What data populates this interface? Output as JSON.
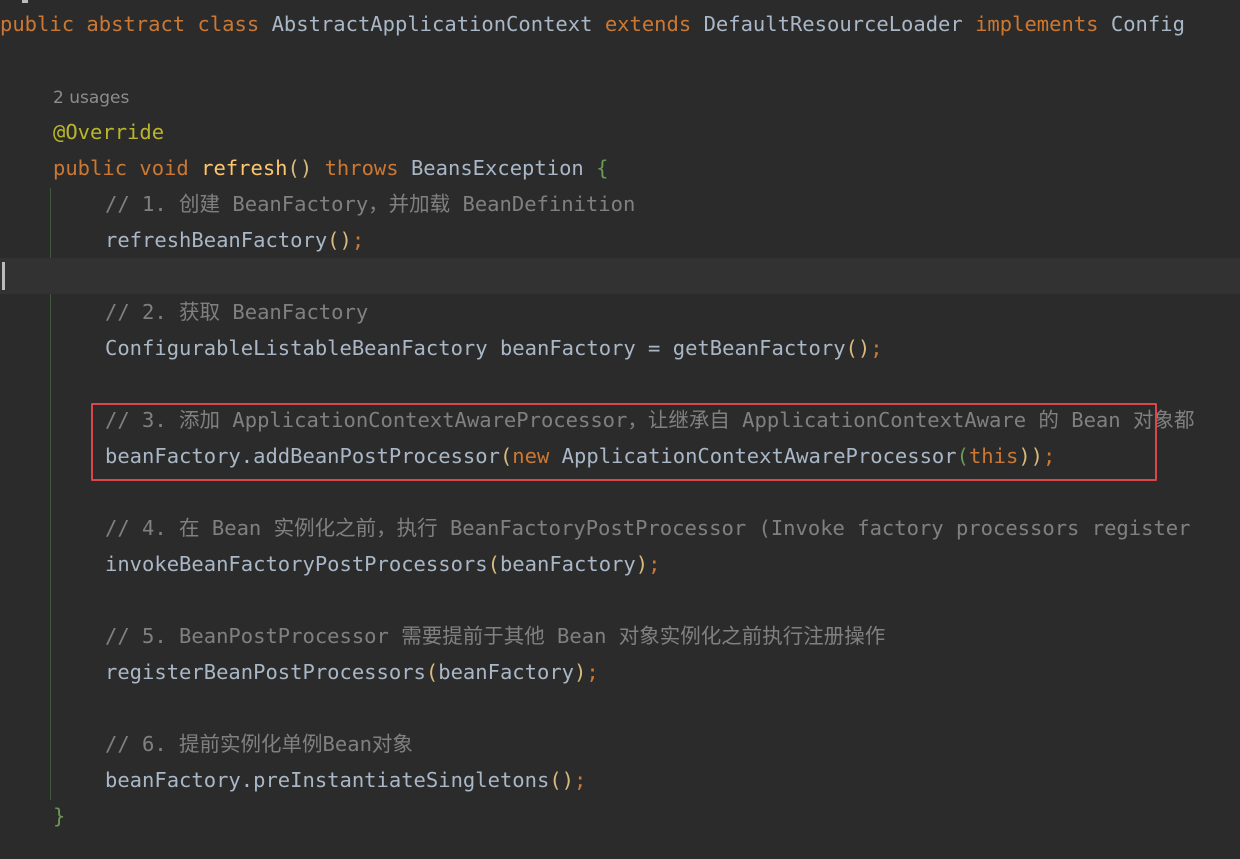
{
  "code": {
    "class_decl": {
      "kw_public": "public",
      "kw_abstract": "abstract",
      "kw_class": "class",
      "class_name": "AbstractApplicationContext",
      "kw_extends": "extends",
      "super_name": "DefaultResourceLoader",
      "kw_implements": "implements",
      "iface_name": "Config"
    },
    "usages": "2 usages",
    "annotation": "@Override",
    "method_decl": {
      "kw_public": "public",
      "kw_void": "void",
      "name": "refresh",
      "parens": "()",
      "kw_throws": "throws",
      "exception": "BeansException",
      "open_brace": "{"
    },
    "comment_1": "// 1. 创建 BeanFactory，并加载 BeanDefinition",
    "stmt_1_call": "refreshBeanFactory",
    "stmt_1_paren": "()",
    "comment_2": "// 2. 获取 BeanFactory",
    "stmt_2_type": "ConfigurableListableBeanFactory",
    "stmt_2_rest": "beanFactory = ",
    "stmt_2_call": "getBeanFactory",
    "stmt_2_paren": "()",
    "comment_3": "// 3. 添加 ApplicationContextAwareProcessor，让继承自 ApplicationContextAware 的 Bean 对象都",
    "stmt_3_call": "beanFactory.addBeanPostProcessor",
    "stmt_3_open": "(",
    "stmt_3_new": "new",
    "stmt_3_ctor": "ApplicationContextAwareProcessor",
    "stmt_3_open2": "(",
    "stmt_3_this": "this",
    "stmt_3_close": "))",
    "comment_4": "// 4. 在 Bean 实例化之前，执行 BeanFactoryPostProcessor (Invoke factory processors register",
    "stmt_4_call": "invokeBeanFactoryPostProcessors",
    "stmt_4_open": "(",
    "stmt_4_arg": "beanFactory",
    "stmt_4_close": ")",
    "comment_5": "// 5. BeanPostProcessor 需要提前于其他 Bean 对象实例化之前执行注册操作",
    "stmt_5_call": "registerBeanPostProcessors",
    "stmt_5_open": "(",
    "stmt_5_arg": "beanFactory",
    "stmt_5_close": ")",
    "comment_6": "// 6. 提前实例化单例Bean对象",
    "stmt_6_call": "beanFactory.preInstantiateSingletons",
    "stmt_6_paren": "()",
    "semicolon": ";",
    "close_brace": "}"
  },
  "colors": {
    "background": "#2b2b2b",
    "keyword": "#cc7832",
    "annotation": "#bbb529",
    "method": "#ffc66d",
    "comment": "#808080",
    "text": "#a9b7c6",
    "highlight_border": "#d9474a"
  }
}
